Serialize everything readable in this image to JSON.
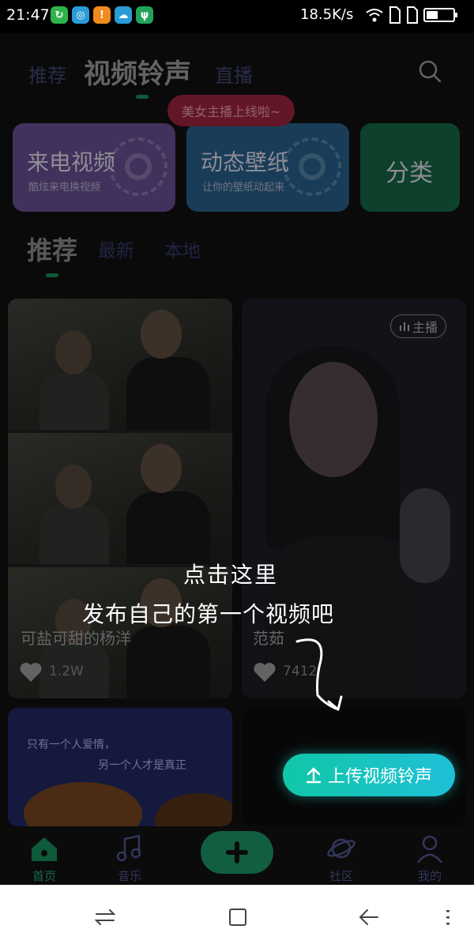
{
  "status_bar": {
    "time": "21:47",
    "network_speed": "18.5K/s",
    "left_icons": [
      "app-badge-icon",
      "swirl-app-icon",
      "warning-icon",
      "weather-app-icon",
      "usb-icon"
    ],
    "right_icons": [
      "wifi-icon",
      "sim-card-icon",
      "sim-card-icon",
      "battery-icon"
    ]
  },
  "top_nav": {
    "tabs": [
      {
        "label": "推荐"
      },
      {
        "label": "视频铃声"
      },
      {
        "label": "直播"
      }
    ],
    "active_tab": "视频铃声",
    "live_bubble": "美女主播上线啦~"
  },
  "features": [
    {
      "title": "来电视频",
      "subtitle": "酷炫来电换视频"
    },
    {
      "title": "动态壁纸",
      "subtitle": "让你的壁纸动起来"
    },
    {
      "title": "分类",
      "subtitle": ""
    }
  ],
  "sub_tabs": [
    {
      "label": "推荐"
    },
    {
      "label": "最新"
    },
    {
      "label": "本地"
    }
  ],
  "cards": [
    {
      "title": "可盐可甜的杨洋",
      "likes": "1.2W"
    },
    {
      "title": "范茹",
      "likes": "7412",
      "tag": "主播"
    },
    {
      "caption1": "只有一个人爱情，",
      "caption2": "另一个人才是真正"
    }
  ],
  "tutorial": {
    "line1": "点击这里",
    "line2": "发布自己的第一个视频吧",
    "upload_label": "上传视频铃声"
  },
  "bottom_nav": [
    {
      "label": "首页",
      "icon": "home-icon"
    },
    {
      "label": "音乐",
      "icon": "music-note-icon"
    },
    {
      "label": "",
      "icon": "plus-icon"
    },
    {
      "label": "社区",
      "icon": "planet-icon"
    },
    {
      "label": "我的",
      "icon": "person-icon"
    }
  ],
  "colors": {
    "accent": "#1a7b4e",
    "upload_gradient_start": "#10c7a7",
    "upload_gradient_end": "#1fc0d8",
    "live_bubble": "#8a1f36"
  }
}
